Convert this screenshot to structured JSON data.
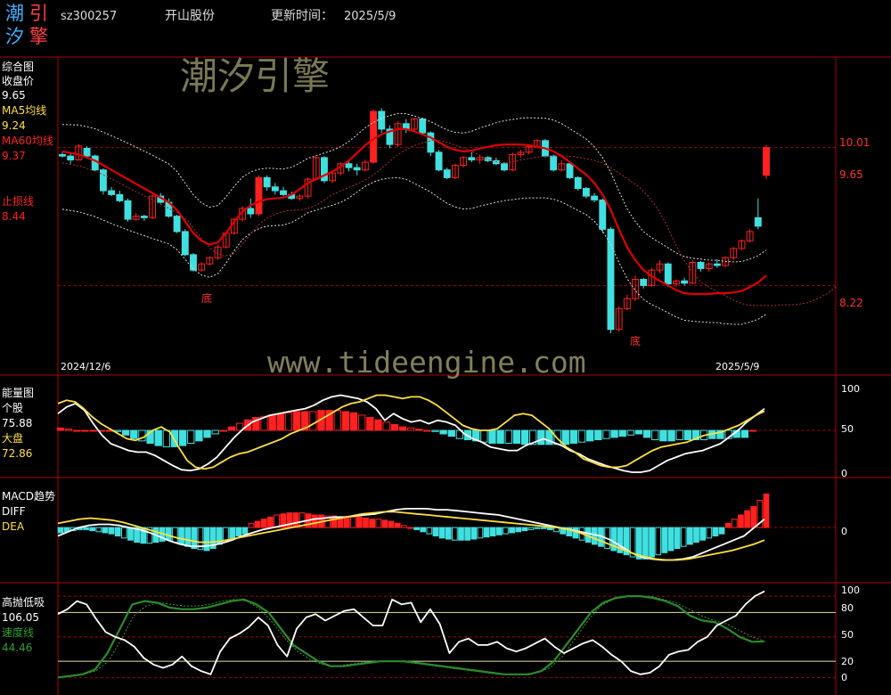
{
  "colors": {
    "bg": "#000000",
    "axis": "#b00000",
    "up": "#ff2020",
    "down": "#40e0e0",
    "white": "#ffffff",
    "yellow": "#ffe040",
    "green": "#2a8c2a",
    "gray": "#bbbbbb"
  },
  "header": {
    "logo_chars": [
      "潮",
      "引",
      "汐",
      "擎"
    ],
    "code": "sz300257",
    "name": "开山股份",
    "update_label": "更新时间：",
    "update_date": "2025/5/9"
  },
  "watermark": {
    "title": "潮汐引擎",
    "url": "www.tideengine.com"
  },
  "panels": {
    "main": {
      "title": "综合图",
      "close_label": "收盘价",
      "close_value": "9.65",
      "ma5_label": "MA5均线",
      "ma5_value": "9.24",
      "ma60_label": "MA60均线",
      "ma60_value": "9.37",
      "stop_label": "止损线",
      "stop_value": "8.44",
      "date_start": "2024/12/6",
      "date_end": "2025/5/9",
      "bottom_marks": [
        "底",
        "底"
      ],
      "right_ticks": [
        "10.01",
        "9.65",
        "8.22"
      ]
    },
    "energy": {
      "title": "能量图",
      "stock_label": "个股",
      "stock_value": "75.88",
      "market_label": "大盘",
      "market_value": "72.86",
      "right_ticks": [
        "100",
        "50",
        "0"
      ]
    },
    "macd": {
      "title": "MACD趋势",
      "diff_label": "DIFF",
      "dea_label": "DEA",
      "right_ticks": [
        "0"
      ]
    },
    "highlow": {
      "title": "高抛低吸",
      "value": "106.05",
      "speed_label": "速度线",
      "speed_value": "44.46",
      "right_ticks": [
        "100",
        "80",
        "50",
        "20",
        "0"
      ]
    }
  },
  "chart_data": [
    {
      "type": "candlestick",
      "name": "综合图",
      "ylim": [
        7.3,
        11.0
      ],
      "ref_lines": [
        10.01,
        8.22
      ],
      "candles": [
        [
          9.92,
          9.95,
          9.88,
          9.9
        ],
        [
          9.9,
          9.93,
          9.8,
          9.85
        ],
        [
          9.85,
          10.05,
          9.84,
          10.03
        ],
        [
          10.0,
          10.03,
          9.88,
          9.9
        ],
        [
          9.9,
          9.92,
          9.7,
          9.72
        ],
        [
          9.72,
          9.74,
          9.4,
          9.45
        ],
        [
          9.45,
          9.5,
          9.38,
          9.4
        ],
        [
          9.4,
          9.45,
          9.3,
          9.32
        ],
        [
          9.32,
          9.35,
          9.05,
          9.08
        ],
        [
          9.08,
          9.16,
          9.06,
          9.12
        ],
        [
          9.12,
          9.14,
          9.06,
          9.1
        ],
        [
          9.1,
          9.4,
          9.08,
          9.38
        ],
        [
          9.38,
          9.42,
          9.28,
          9.3
        ],
        [
          9.3,
          9.35,
          9.1,
          9.12
        ],
        [
          9.12,
          9.14,
          8.9,
          8.92
        ],
        [
          8.92,
          8.95,
          8.6,
          8.62
        ],
        [
          8.62,
          8.64,
          8.4,
          8.42
        ],
        [
          8.42,
          8.52,
          8.4,
          8.5
        ],
        [
          8.5,
          8.6,
          8.48,
          8.58
        ],
        [
          8.58,
          8.75,
          8.55,
          8.72
        ],
        [
          8.72,
          8.92,
          8.7,
          8.9
        ],
        [
          8.9,
          9.1,
          8.88,
          9.08
        ],
        [
          9.08,
          9.25,
          9.05,
          9.22
        ],
        [
          9.22,
          9.35,
          9.1,
          9.15
        ],
        [
          9.15,
          9.65,
          9.12,
          9.62
        ],
        [
          9.62,
          9.65,
          9.45,
          9.5
        ],
        [
          9.5,
          9.55,
          9.4,
          9.45
        ],
        [
          9.45,
          9.5,
          9.38,
          9.4
        ],
        [
          9.4,
          9.44,
          9.33,
          9.35
        ],
        [
          9.35,
          9.4,
          9.32,
          9.38
        ],
        [
          9.38,
          9.62,
          9.35,
          9.6
        ],
        [
          9.6,
          9.9,
          9.58,
          9.88
        ],
        [
          9.88,
          9.9,
          9.55,
          9.58
        ],
        [
          9.58,
          9.7,
          9.55,
          9.68
        ],
        [
          9.68,
          9.82,
          9.65,
          9.8
        ],
        [
          9.8,
          9.85,
          9.7,
          9.75
        ],
        [
          9.75,
          9.8,
          9.65,
          9.72
        ],
        [
          9.72,
          9.85,
          9.7,
          9.82
        ],
        [
          9.82,
          10.5,
          9.8,
          10.48
        ],
        [
          10.48,
          10.52,
          10.2,
          10.25
        ],
        [
          10.25,
          10.3,
          10.0,
          10.05
        ],
        [
          10.05,
          10.35,
          10.02,
          10.32
        ],
        [
          10.32,
          10.38,
          10.2,
          10.25
        ],
        [
          10.25,
          10.4,
          10.22,
          10.38
        ],
        [
          10.38,
          10.4,
          10.18,
          10.2
        ],
        [
          10.2,
          10.22,
          9.9,
          9.95
        ],
        [
          9.95,
          9.98,
          9.7,
          9.72
        ],
        [
          9.72,
          9.75,
          9.6,
          9.62
        ],
        [
          9.62,
          9.8,
          9.6,
          9.78
        ],
        [
          9.78,
          9.9,
          9.75,
          9.88
        ],
        [
          9.88,
          9.95,
          9.82,
          9.85
        ],
        [
          9.85,
          9.92,
          9.8,
          9.88
        ],
        [
          9.88,
          9.9,
          9.82,
          9.84
        ],
        [
          9.84,
          9.88,
          9.78,
          9.8
        ],
        [
          9.8,
          9.82,
          9.7,
          9.72
        ],
        [
          9.72,
          9.95,
          9.7,
          9.92
        ],
        [
          9.92,
          9.98,
          9.88,
          9.95
        ],
        [
          9.95,
          10.05,
          9.92,
          10.02
        ],
        [
          10.02,
          10.12,
          10.0,
          10.1
        ],
        [
          10.1,
          10.12,
          9.88,
          9.9
        ],
        [
          9.9,
          9.92,
          9.7,
          9.72
        ],
        [
          9.72,
          9.85,
          9.7,
          9.8
        ],
        [
          9.8,
          9.82,
          9.6,
          9.62
        ],
        [
          9.62,
          9.64,
          9.45,
          9.48
        ],
        [
          9.48,
          9.5,
          9.35,
          9.38
        ],
        [
          9.38,
          9.42,
          9.3,
          9.33
        ],
        [
          9.33,
          9.35,
          8.9,
          8.95
        ],
        [
          8.95,
          8.98,
          7.6,
          7.65
        ],
        [
          7.65,
          7.95,
          7.62,
          7.92
        ],
        [
          7.92,
          8.1,
          7.9,
          8.05
        ],
        [
          8.05,
          8.35,
          8.02,
          8.3
        ],
        [
          8.3,
          8.32,
          8.18,
          8.22
        ],
        [
          8.22,
          8.45,
          8.2,
          8.42
        ],
        [
          8.42,
          8.55,
          8.38,
          8.5
        ],
        [
          8.5,
          8.52,
          8.2,
          8.24
        ],
        [
          8.24,
          8.3,
          8.2,
          8.28
        ],
        [
          8.28,
          8.32,
          8.22,
          8.25
        ],
        [
          8.25,
          8.55,
          8.24,
          8.52
        ],
        [
          8.52,
          8.54,
          8.4,
          8.44
        ],
        [
          8.44,
          8.52,
          8.4,
          8.5
        ],
        [
          8.5,
          8.56,
          8.45,
          8.48
        ],
        [
          8.48,
          8.6,
          8.46,
          8.58
        ],
        [
          8.58,
          8.72,
          8.55,
          8.7
        ],
        [
          8.7,
          8.82,
          8.68,
          8.8
        ],
        [
          8.8,
          8.95,
          8.78,
          8.92
        ],
        [
          9.1,
          9.35,
          8.95,
          8.99
        ],
        [
          9.65,
          10.05,
          9.6,
          10.01
        ]
      ],
      "ma60": [
        9.96,
        9.94,
        9.92,
        9.88,
        9.84,
        9.78,
        9.72,
        9.66,
        9.6,
        9.54,
        9.48,
        9.42,
        9.36,
        9.3,
        9.2,
        9.05,
        8.9,
        8.8,
        8.75,
        8.78,
        8.9,
        9.05,
        9.18,
        9.26,
        9.31,
        9.34,
        9.35,
        9.36,
        9.4,
        9.47,
        9.55,
        9.6,
        9.65,
        9.7,
        9.76,
        9.84,
        9.94,
        10.04,
        10.12,
        10.18,
        10.22,
        10.25,
        10.25,
        10.22,
        10.18,
        10.14,
        10.08,
        10.02,
        9.98,
        9.96,
        9.97,
        10.0,
        10.02,
        10.04,
        10.05,
        10.05,
        10.05,
        10.04,
        10.02,
        10.0,
        9.96,
        9.9,
        9.82,
        9.74,
        9.66,
        9.55,
        9.4,
        9.2,
        8.95,
        8.72,
        8.55,
        8.42,
        8.34,
        8.28,
        8.22,
        8.16,
        8.12,
        8.11,
        8.11,
        8.11,
        8.12,
        8.12,
        8.13,
        8.15,
        8.2,
        8.26,
        8.35
      ]
    },
    {
      "type": "bar+line",
      "name": "能量图",
      "ylim": [
        0,
        100
      ],
      "series": [
        {
          "name": "个股",
          "last": 75.88
        },
        {
          "name": "大盘",
          "last": 72.86
        }
      ],
      "bars": [
        2,
        1,
        0,
        0,
        0,
        0,
        0,
        -1,
        -4,
        -7,
        -9,
        -11,
        -13,
        -14,
        -14,
        -13,
        -11,
        -9,
        -6,
        -3,
        0,
        3,
        6,
        9,
        11,
        12,
        13,
        14,
        15,
        16,
        16,
        16,
        17,
        17,
        17,
        16,
        15,
        13,
        11,
        9,
        7,
        5,
        3,
        2,
        1,
        0,
        -1,
        -3,
        -5,
        -7,
        -8,
        -9,
        -10,
        -11,
        -11,
        -11,
        -11,
        -12,
        -12,
        -12,
        -12,
        -12,
        -12,
        -11,
        -10,
        -9,
        -8,
        -7,
        -6,
        -5,
        -4,
        -3,
        -6,
        -8,
        -9,
        -9,
        -8,
        -8,
        -8,
        -8,
        -7,
        -7,
        -7,
        -6,
        -6,
        0
      ],
      "white": [
        70,
        78,
        82,
        74,
        58,
        44,
        34,
        30,
        26,
        24,
        24,
        20,
        14,
        8,
        3,
        2,
        4,
        10,
        18,
        30,
        42,
        52,
        60,
        64,
        68,
        70,
        72,
        74,
        76,
        80,
        86,
        90,
        92,
        90,
        88,
        84,
        76,
        62,
        70,
        64,
        60,
        62,
        58,
        62,
        60,
        56,
        46,
        40,
        36,
        30,
        28,
        26,
        26,
        32,
        36,
        40,
        36,
        32,
        26,
        22,
        16,
        12,
        8,
        5,
        2,
        0,
        0,
        2,
        8,
        14,
        18,
        22,
        24,
        26,
        30,
        34,
        42,
        50,
        60,
        68,
        75.88
      ],
      "yellow": [
        82,
        86,
        84,
        76,
        66,
        58,
        52,
        46,
        40,
        38,
        42,
        50,
        54,
        48,
        30,
        14,
        6,
        4,
        6,
        12,
        18,
        22,
        24,
        28,
        32,
        36,
        40,
        46,
        50,
        54,
        60,
        66,
        72,
        78,
        82,
        84,
        88,
        92,
        92,
        90,
        88,
        90,
        90,
        86,
        80,
        72,
        64,
        56,
        52,
        50,
        50,
        52,
        60,
        68,
        70,
        68,
        60,
        52,
        40,
        30,
        24,
        16,
        12,
        8,
        6,
        6,
        8,
        14,
        20,
        26,
        30,
        32,
        34,
        36,
        40,
        44,
        46,
        48,
        52,
        56,
        62,
        68,
        72.86
      ]
    },
    {
      "type": "bar+line",
      "name": "MACD趋势",
      "ylim": [
        -45,
        40
      ],
      "bars": [
        -5,
        -4,
        -3,
        -2,
        -2,
        -3,
        -4,
        -5,
        -6,
        -8,
        -10,
        -12,
        -14,
        -15,
        -15,
        -14,
        -13,
        -12,
        -14,
        -16,
        -18,
        -20,
        -21,
        -22,
        -20,
        -16,
        -12,
        -10,
        -8,
        -6,
        4,
        6,
        8,
        10,
        12,
        13,
        14,
        14,
        14,
        13,
        12,
        12,
        11,
        11,
        10,
        10,
        10,
        10,
        9,
        8,
        8,
        7,
        6,
        4,
        2,
        0,
        -2,
        -4,
        -6,
        -8,
        -10,
        -11,
        -12,
        -12,
        -12,
        -11,
        -10,
        -9,
        -8,
        -7,
        -6,
        -5,
        -4,
        -3,
        -2,
        -1,
        -1,
        -2,
        -4,
        -6,
        -8,
        -10,
        -12,
        -14,
        -16,
        -18,
        -20,
        -22,
        -24,
        -26,
        -28,
        -30,
        -30,
        -28,
        -26,
        -24,
        -22,
        -20,
        -18,
        -16,
        -14,
        -12,
        -10,
        -8,
        -6,
        4,
        8,
        12,
        16,
        20,
        26,
        32
      ],
      "white": [
        -8,
        -4,
        0,
        2,
        3,
        3,
        2,
        0,
        -2,
        -5,
        -9,
        -13,
        -16,
        -18,
        -18,
        -17,
        -15,
        -12,
        -8,
        -5,
        -2,
        0,
        2,
        4,
        6,
        8,
        9,
        10,
        10,
        11,
        12,
        13,
        15,
        17,
        18,
        18,
        18,
        17,
        17,
        16,
        15,
        14,
        13,
        12,
        10,
        8,
        6,
        4,
        2,
        0,
        -2,
        -4,
        -6,
        -8,
        -12,
        -18,
        -24,
        -28,
        -30,
        -31,
        -31,
        -30,
        -28,
        -24,
        -20,
        -16,
        -12,
        -8,
        0,
        8
      ],
      "yellow": [
        4,
        6,
        8,
        9,
        8,
        7,
        5,
        2,
        -1,
        -4,
        -7,
        -10,
        -12,
        -14,
        -14,
        -13,
        -11,
        -9,
        -7,
        -5,
        -3,
        -1,
        1,
        3,
        5,
        7,
        9,
        11,
        13,
        14,
        15,
        15,
        14,
        13,
        12,
        11,
        10,
        9,
        8,
        7,
        6,
        5,
        4,
        3,
        2,
        1,
        0,
        -2,
        -5,
        -9,
        -13,
        -17,
        -21,
        -25,
        -28,
        -30,
        -31,
        -31,
        -30,
        -28,
        -26,
        -24,
        -22,
        -19,
        -16,
        -12
      ]
    },
    {
      "type": "line",
      "name": "高抛低吸",
      "ylim": [
        -5,
        110
      ],
      "ref_lines": [
        100,
        80,
        50,
        20,
        0
      ],
      "series": [
        {
          "name": "高抛低吸",
          "last": 106.05
        },
        {
          "name": "速度线",
          "last": 44.46
        }
      ],
      "white": [
        78,
        84,
        94,
        90,
        72,
        56,
        50,
        46,
        38,
        24,
        16,
        12,
        16,
        26,
        14,
        8,
        4,
        32,
        48,
        54,
        62,
        74,
        64,
        40,
        26,
        60,
        74,
        78,
        70,
        76,
        82,
        84,
        74,
        64,
        64,
        96,
        90,
        92,
        68,
        84,
        66,
        30,
        44,
        48,
        40,
        40,
        44,
        36,
        32,
        36,
        42,
        48,
        38,
        30,
        36,
        42,
        46,
        38,
        28,
        20,
        8,
        4,
        6,
        14,
        28,
        32,
        34,
        44,
        50,
        64,
        70,
        76,
        90,
        100,
        106.05
      ],
      "green": [
        0,
        2,
        4,
        10,
        30,
        60,
        90,
        94,
        92,
        86,
        84,
        84,
        86,
        90,
        94,
        96,
        90,
        80,
        60,
        40,
        30,
        20,
        14,
        14,
        16,
        18,
        20,
        20,
        20,
        18,
        16,
        14,
        12,
        10,
        8,
        6,
        4,
        4,
        4,
        8,
        20,
        40,
        60,
        80,
        92,
        98,
        100,
        100,
        98,
        94,
        88,
        76,
        70,
        68,
        60,
        50,
        44,
        44.46
      ],
      "green_dashed": [
        0,
        2,
        4,
        8,
        20,
        46,
        76,
        88,
        92,
        90,
        88,
        88,
        90,
        94,
        96,
        94,
        84,
        68,
        48,
        32,
        22,
        16,
        14,
        16,
        18,
        20,
        20,
        20,
        18,
        16,
        14,
        12,
        10,
        8,
        6,
        4,
        4,
        4,
        6,
        12,
        26,
        48,
        70,
        88,
        96,
        100,
        100,
        100,
        96,
        92,
        84,
        76,
        70,
        66,
        58,
        50,
        45
      ]
    }
  ]
}
